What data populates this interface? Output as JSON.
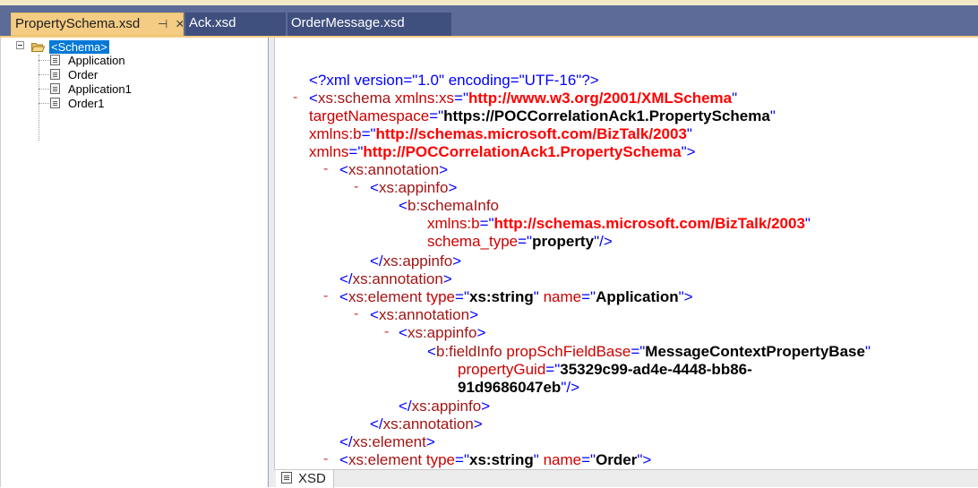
{
  "tabs": [
    {
      "label": "PropertySchema.xsd",
      "active": true,
      "pin": "⊣",
      "close": "×"
    },
    {
      "label": "Ack.xsd",
      "active": false
    },
    {
      "label": "OrderMessage.xsd",
      "active": false
    }
  ],
  "tree": {
    "root_label": "<Schema>",
    "children": [
      "Application",
      "Order",
      "Application1",
      "Order1"
    ]
  },
  "xml": {
    "decl": "<?xml version=\"1.0\" encoding=\"UTF-16\"?>",
    "schema_ns_xs": "http://www.w3.org/2001/XMLSchema",
    "target_namespace": "https://POCCorrelationAck1.PropertySchema",
    "ns_b": "http://schemas.microsoft.com/BizTalk/2003",
    "ns_default": "http://POCCorrelationAck1.PropertySchema",
    "schema_type": "property",
    "element1_type": "xs:string",
    "element1_name": "Application",
    "prop_base": "MessageContextPropertyBase",
    "guid_part1": "35329c99-ad4e-4448-bb86-",
    "guid_part2": "91d9686047eb",
    "element2_type": "xs:string",
    "element2_name": "Order"
  },
  "bottom_tab": {
    "label": "XSD"
  },
  "colors": {
    "tab_active": "#f5cc84",
    "tabbar_bg": "#5d6b99",
    "selection": "#0078d7",
    "xml_tag": "#0000ff",
    "xml_element": "#a31515",
    "xml_attr": "#cc0000",
    "xml_value": "#ff0000"
  }
}
